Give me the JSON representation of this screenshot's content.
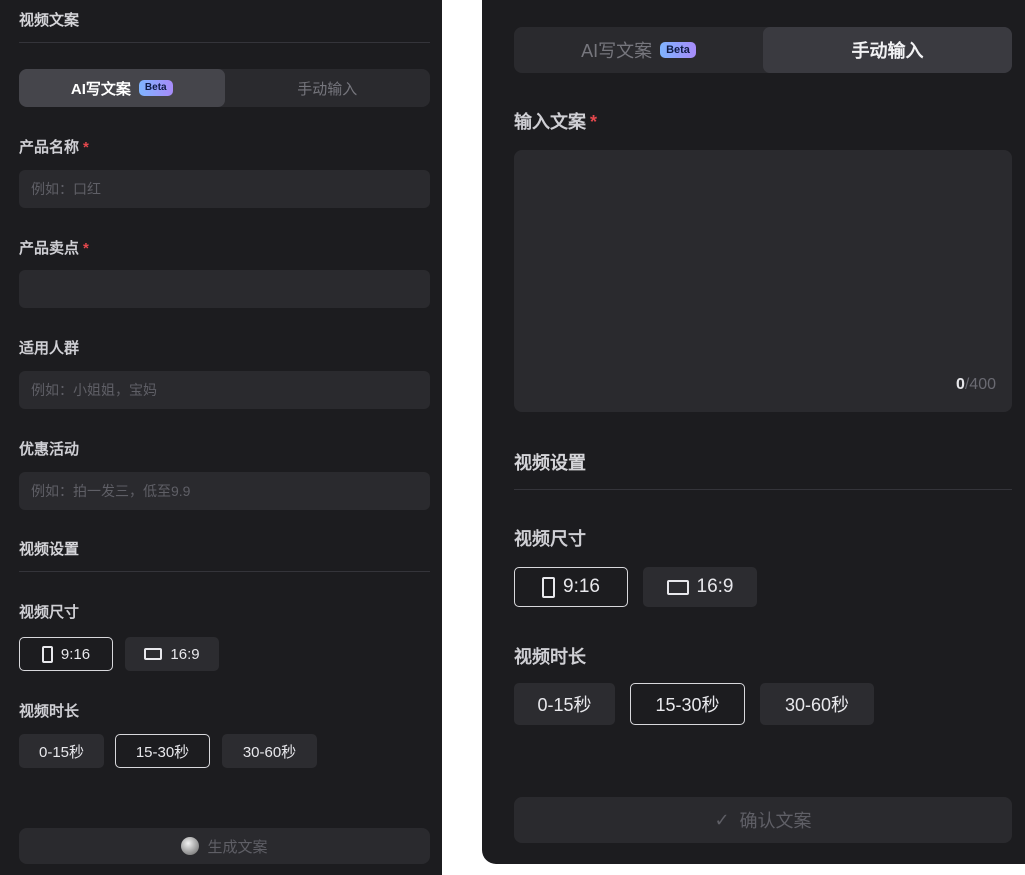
{
  "left": {
    "header": "视频文案",
    "tabs": [
      {
        "label": "AI写文案",
        "badge": "Beta"
      },
      {
        "label": "手动输入"
      }
    ],
    "fields": [
      {
        "label": "产品名称",
        "required": "*",
        "placeholder": "例如：口红",
        "value": ""
      },
      {
        "label": "产品卖点",
        "required": "*",
        "placeholder": "",
        "value": ""
      },
      {
        "label": "适用人群",
        "placeholder": "例如：小姐姐，宝妈",
        "value": ""
      },
      {
        "label": "优惠活动",
        "placeholder": "例如：拍一发三，低至9.9",
        "value": ""
      }
    ],
    "video_settings": "视频设置",
    "size_label": "视频尺寸",
    "sizes": [
      "9:16",
      "16:9"
    ],
    "duration_label": "视频时长",
    "durations": [
      "0-15秒",
      "15-30秒",
      "30-60秒"
    ],
    "generate_button": "生成文案"
  },
  "right": {
    "tabs": [
      {
        "label": "AI写文案",
        "badge": "Beta"
      },
      {
        "label": "手动输入"
      }
    ],
    "input_label": "输入文案",
    "required": "*",
    "counter_current": "0",
    "counter_max": "/400",
    "video_settings": "视频设置",
    "size_label": "视频尺寸",
    "sizes": [
      "9:16",
      "16:9"
    ],
    "duration_label": "视频时长",
    "durations": [
      "0-15秒",
      "15-30秒",
      "30-60秒"
    ],
    "confirm_button": "确认文案"
  }
}
